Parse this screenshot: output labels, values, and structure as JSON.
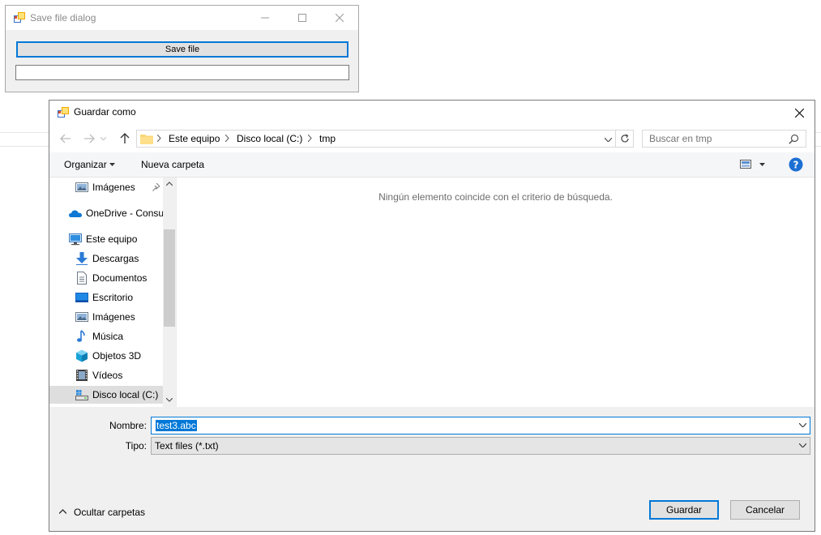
{
  "app": {
    "title": "Save file dialog",
    "save_button_label": "Save file",
    "path_value": ""
  },
  "dialog": {
    "title": "Guardar como",
    "address": {
      "crumbs": [
        "Este equipo",
        "Disco local (C:)",
        "tmp"
      ]
    },
    "search": {
      "placeholder": "Buscar en tmp"
    },
    "toolbar": {
      "organize_label": "Organizar",
      "new_folder_label": "Nueva carpeta"
    },
    "nav_items": [
      {
        "label": "Imágenes",
        "icon": "pictures-icon"
      },
      {
        "label": "OneDrive - Consu",
        "icon": "onedrive-icon"
      },
      {
        "label": "Este equipo",
        "icon": "computer-icon"
      },
      {
        "label": "Descargas",
        "icon": "downloads-icon"
      },
      {
        "label": "Documentos",
        "icon": "documents-icon"
      },
      {
        "label": "Escritorio",
        "icon": "desktop-icon"
      },
      {
        "label": "Imágenes",
        "icon": "pictures-icon"
      },
      {
        "label": "Música",
        "icon": "music-icon"
      },
      {
        "label": "Objetos 3D",
        "icon": "3d-objects-icon"
      },
      {
        "label": "Vídeos",
        "icon": "videos-icon"
      },
      {
        "label": "Disco local (C:)",
        "icon": "drive-icon"
      }
    ],
    "empty_message": "Ningún elemento coincide con el criterio de búsqueda.",
    "form": {
      "name_label": "Nombre:",
      "name_value": "test3.abc",
      "type_label": "Tipo:",
      "type_value": "Text files (*.txt)"
    },
    "buttons": {
      "save_label": "Guardar",
      "cancel_label": "Cancelar",
      "hide_folders_label": "Ocultar carpetas"
    }
  },
  "colors": {
    "accent": "#0078d7",
    "dialog_bg": "#f0f0f0",
    "selection_bg": "#dedede",
    "muted_text": "#6d6d6d"
  }
}
